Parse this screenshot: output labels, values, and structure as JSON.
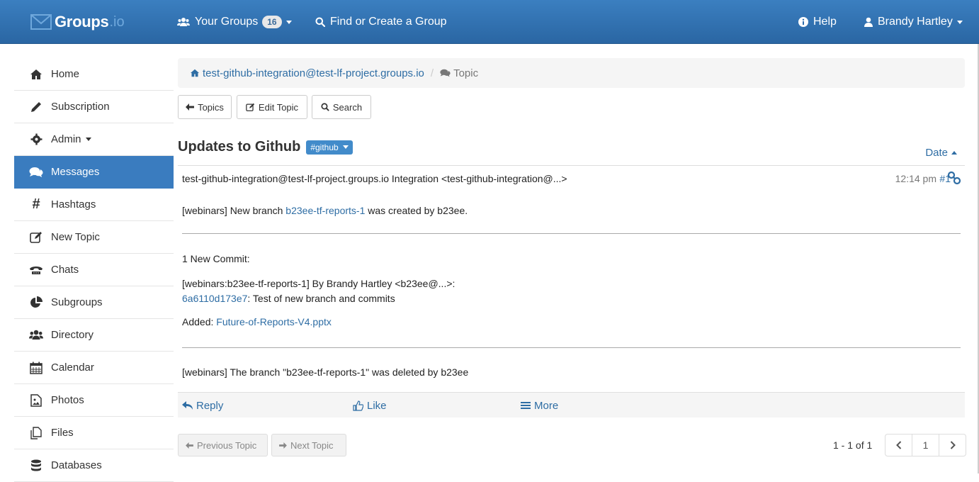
{
  "brand": {
    "name": "Groups",
    "suffix": ".io"
  },
  "nav": {
    "your_groups": "Your Groups",
    "group_count": "16",
    "find_create": "Find or Create a Group",
    "help": "Help",
    "user": "Brandy Hartley"
  },
  "sidebar": {
    "items": [
      {
        "label": "Home",
        "icon": "home-icon"
      },
      {
        "label": "Subscription",
        "icon": "pencil-icon"
      },
      {
        "label": "Admin",
        "icon": "gear-icon"
      },
      {
        "label": "Messages",
        "icon": "comments-icon"
      },
      {
        "label": "Hashtags",
        "icon": "hashtag-icon"
      },
      {
        "label": "New Topic",
        "icon": "edit-icon"
      },
      {
        "label": "Chats",
        "icon": "chat-icon"
      },
      {
        "label": "Subgroups",
        "icon": "pie-icon"
      },
      {
        "label": "Directory",
        "icon": "users-icon"
      },
      {
        "label": "Calendar",
        "icon": "calendar-icon"
      },
      {
        "label": "Photos",
        "icon": "photo-icon"
      },
      {
        "label": "Files",
        "icon": "files-icon"
      },
      {
        "label": "Databases",
        "icon": "database-icon"
      }
    ]
  },
  "breadcrumb": {
    "group": "test-github-integration@test-lf-project.groups.io",
    "current": "Topic"
  },
  "toolbar": {
    "topics": "Topics",
    "edit_topic": "Edit Topic",
    "search": "Search"
  },
  "topic": {
    "title": "Updates to Github",
    "hashtag": "#github",
    "sort_label": "Date"
  },
  "message": {
    "from": "test-github-integration@test-lf-project.groups.io Integration <test-github-integration@...>",
    "time": "12:14 pm",
    "number": "#1",
    "line1_pre": "[webinars] New branch ",
    "line1_link": "b23ee-tf-reports-1",
    "line1_post": " was created by b23ee.",
    "commits_header": "1 New Commit:",
    "commit_line": "[webinars:b23ee-tf-reports-1] By Brandy Hartley <b23ee@...>:",
    "commit_hash": "6a6110d173e7",
    "commit_msg": ": Test of new branch and commits",
    "added_label": "Added: ",
    "added_file": "Future-of-Reports-V4.pptx",
    "deleted_line": "[webinars] The branch \"b23ee-tf-reports-1\" was deleted by b23ee"
  },
  "actions": {
    "reply": "Reply",
    "like": "Like",
    "more": "More"
  },
  "footer": {
    "prev": "Previous Topic",
    "next": "Next Topic",
    "page_info": "1 - 1 of 1",
    "page": "1"
  },
  "colors": {
    "navbar": "#2f71b2",
    "active": "#3a7cbf",
    "link": "#2e6da4",
    "tag": "#428bca"
  }
}
